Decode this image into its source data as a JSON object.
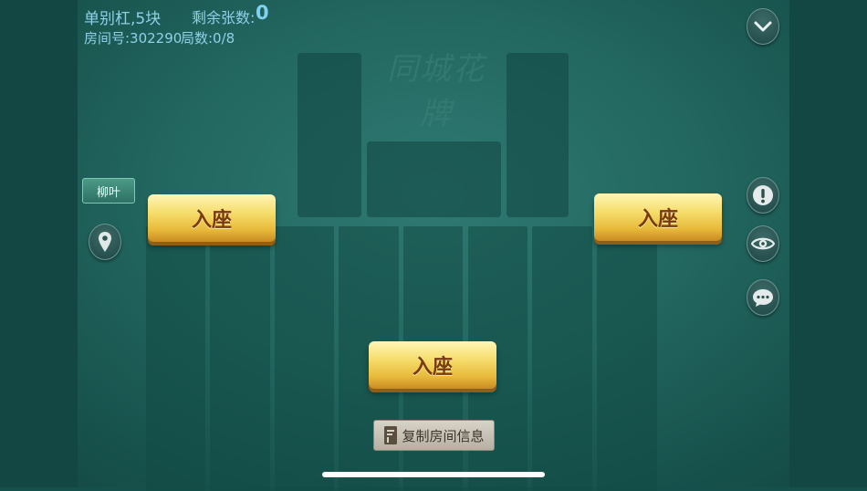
{
  "header": {
    "rule": "单别杠,5块",
    "remaining_label": "剩余张数:",
    "remaining_value": "0",
    "room_label": "房间号:302290",
    "rounds_label": "局数:0/8"
  },
  "watermark": "同城花牌",
  "seats": {
    "left_label": "入座",
    "right_label": "入座",
    "bottom_label": "入座"
  },
  "player_name": "柳叶",
  "copy_button": "复制房间信息",
  "icons": {
    "collapse": "chevron-down-icon",
    "location": "location-pin-icon",
    "info": "exclamation-icon",
    "watch": "eye-icon",
    "chat": "chat-bubble-icon",
    "copy": "document-icon"
  }
}
